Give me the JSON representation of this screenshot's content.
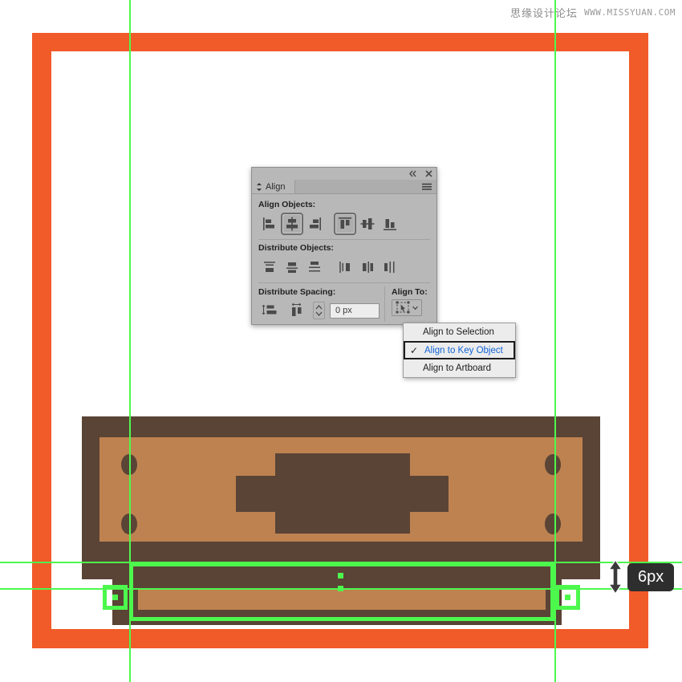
{
  "watermark": {
    "cn_text": "思缘设计论坛",
    "url_text": "WWW.MISSYUAN.COM"
  },
  "colors": {
    "orange_frame": "#F15A29",
    "wood_dark": "#5A4436",
    "wood_light": "#BE8250",
    "guide_green": "#4DF84D",
    "panel_gray": "#B8B8B8",
    "menu_highlight_blue": "#1164D6",
    "tooltip_bg": "#2E2E2E"
  },
  "canvas": {
    "artwork_name": "orange-framed-cabinet-illustration",
    "selection_label": "selected-drawer-shelf"
  },
  "measurement": {
    "value": "6px",
    "icon": "vertical-double-arrow-icon"
  },
  "align_panel": {
    "title": "Align",
    "titlebar": {
      "collapse_icon": "collapse-double-chevron-icon",
      "close_icon": "close-icon"
    },
    "menu_icon": "panel-menu-icon",
    "sections": {
      "align_objects": {
        "label": "Align Objects:",
        "buttons": [
          {
            "name": "horizontal-align-left-button",
            "icon": "align-left-icon",
            "pressed": false
          },
          {
            "name": "horizontal-align-center-button",
            "icon": "align-horizontal-center-icon",
            "pressed": true
          },
          {
            "name": "horizontal-align-right-button",
            "icon": "align-right-icon",
            "pressed": false
          },
          {
            "name": "vertical-align-top-button",
            "icon": "align-top-icon",
            "pressed": true
          },
          {
            "name": "vertical-align-center-button",
            "icon": "align-vertical-center-icon",
            "pressed": false
          },
          {
            "name": "vertical-align-bottom-button",
            "icon": "align-bottom-icon",
            "pressed": false
          }
        ]
      },
      "distribute_objects": {
        "label": "Distribute Objects:",
        "buttons": [
          {
            "name": "distribute-vertical-top-button",
            "icon": "distribute-top-icon"
          },
          {
            "name": "distribute-vertical-center-button",
            "icon": "distribute-vertical-center-icon"
          },
          {
            "name": "distribute-vertical-bottom-button",
            "icon": "distribute-bottom-icon"
          },
          {
            "name": "distribute-horizontal-left-button",
            "icon": "distribute-left-icon"
          },
          {
            "name": "distribute-horizontal-center-button",
            "icon": "distribute-horizontal-center-icon"
          },
          {
            "name": "distribute-horizontal-right-button",
            "icon": "distribute-right-icon"
          }
        ]
      },
      "distribute_spacing": {
        "label": "Distribute Spacing:",
        "buttons": [
          {
            "name": "vertical-distribute-space-button",
            "icon": "vertical-space-icon"
          },
          {
            "name": "horizontal-distribute-space-button",
            "icon": "horizontal-space-icon"
          }
        ],
        "stepper_icon": "stepper-up-down-icon",
        "input_value": "0 px",
        "input_placeholder": "0 px"
      },
      "align_to": {
        "label": "Align To:",
        "button_icon": "align-to-key-object-icon",
        "chevron_icon": "chevron-down-icon"
      }
    }
  },
  "align_to_menu": {
    "items": [
      {
        "label": "Align to Selection",
        "checked": false
      },
      {
        "label": "Align to Key Object",
        "checked": true
      },
      {
        "label": "Align to Artboard",
        "checked": false
      }
    ],
    "check_glyph": "✓"
  }
}
